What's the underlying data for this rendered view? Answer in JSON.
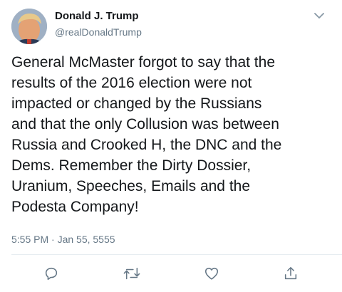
{
  "author": {
    "display_name": "Donald J. Trump",
    "handle": "@realDonaldTrump"
  },
  "tweet": {
    "text": "General McMaster forgot to say that the\nresults of the 2016 election were not\nimpacted or changed by the Russians\nand that the only Collusion was between\nRussia and Crooked H, the DNC and the\nDems. Remember the Dirty Dossier,\nUranium, Speeches, Emails and the\nPodesta Company!",
    "timestamp": "5:55 PM · Jan 55, 5555"
  },
  "icons": {
    "menu": "chevron-down-icon",
    "reply": "reply-icon",
    "retweet": "retweet-icon",
    "like": "heart-icon",
    "share": "share-icon"
  },
  "colors": {
    "text": "#14171a",
    "secondary_text": "#657786",
    "icon": "#657786",
    "divider": "#e6ecf0"
  }
}
